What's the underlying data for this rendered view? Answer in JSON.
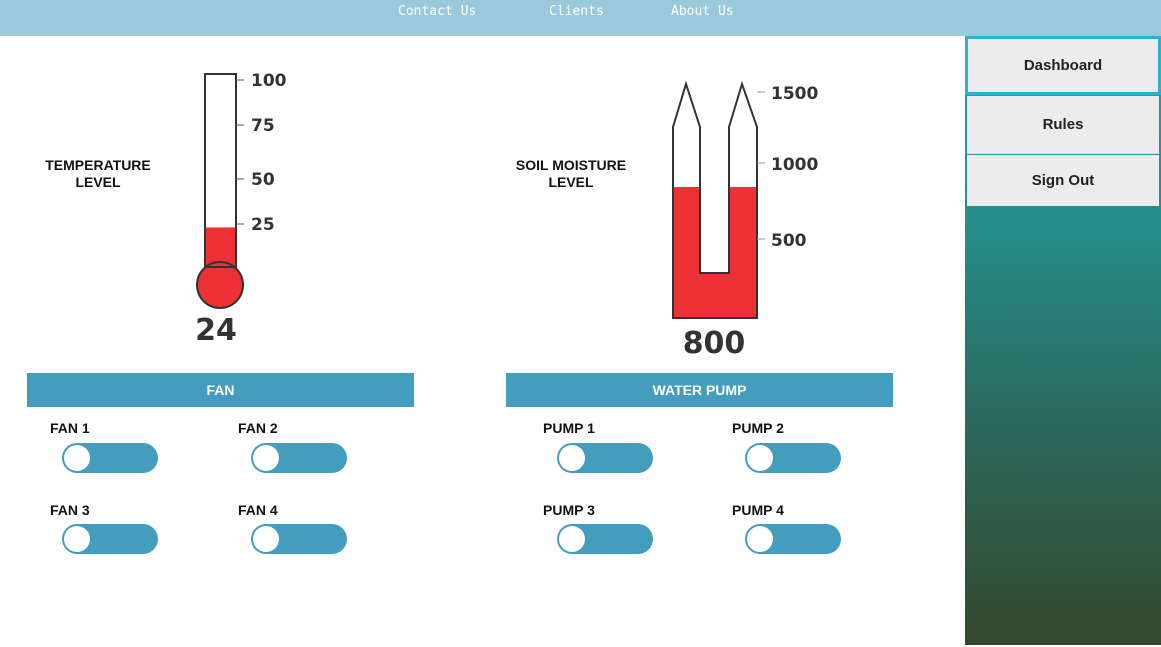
{
  "nav": {
    "contact": "Contact Us",
    "clients": "Clients",
    "about": "About Us"
  },
  "sidebar": {
    "dashboard": "Dashboard",
    "rules": "Rules",
    "signout": "Sign Out"
  },
  "temperature": {
    "label_line1": "TEMPERATURE",
    "label_line2": "LEVEL",
    "value": 24,
    "display": "24",
    "scale_max": 100,
    "ticks": [
      "100",
      "75",
      "50",
      "25"
    ],
    "fill_color": "#ee3137"
  },
  "soil": {
    "label_line1": "SOIL MOISTURE",
    "label_line2": "LEVEL",
    "value": 800,
    "display": "800",
    "ticks": [
      "1500",
      "1000",
      "500"
    ],
    "fill_color": "#ee3137"
  },
  "fan_section": {
    "title": "FAN",
    "devices": [
      {
        "label": "FAN 1",
        "on": false
      },
      {
        "label": "FAN 2",
        "on": false
      },
      {
        "label": "FAN 3",
        "on": false
      },
      {
        "label": "FAN 4",
        "on": false
      }
    ]
  },
  "pump_section": {
    "title": "WATER PUMP",
    "devices": [
      {
        "label": "PUMP 1",
        "on": false
      },
      {
        "label": "PUMP 2",
        "on": false
      },
      {
        "label": "PUMP 3",
        "on": false
      },
      {
        "label": "PUMP 4",
        "on": false
      }
    ]
  },
  "colors": {
    "accent": "#459dbd",
    "nav_bg": "#99c9da",
    "gauge_fill": "#ee3137"
  }
}
